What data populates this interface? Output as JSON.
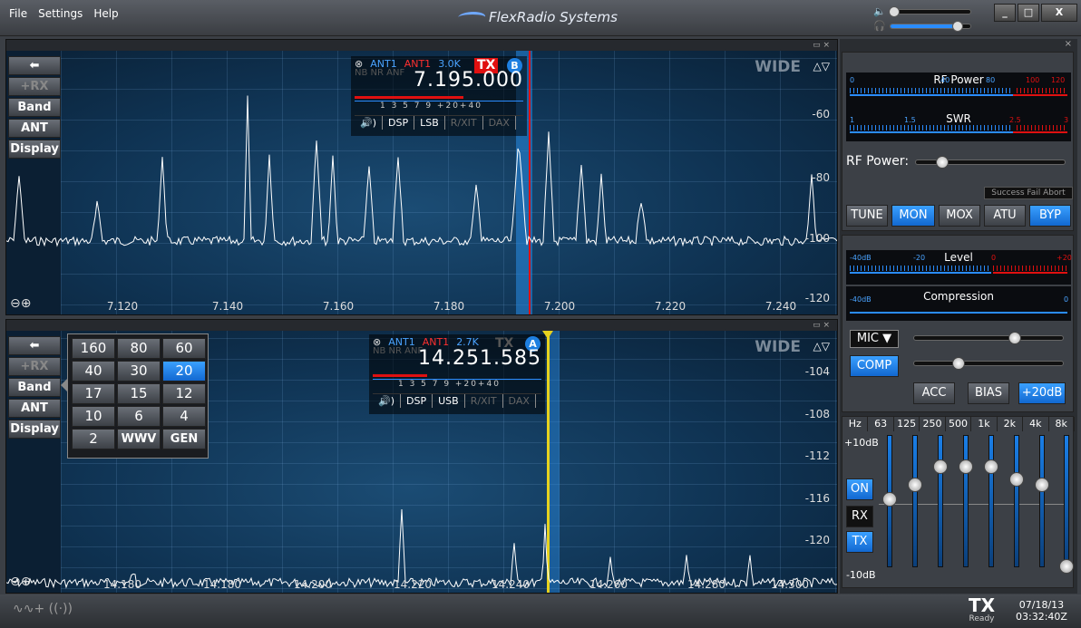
{
  "app": {
    "menu": [
      "File",
      "Settings",
      "Help"
    ],
    "brand": "FlexRadio Systems",
    "window_buttons": [
      "_",
      "□",
      "X"
    ]
  },
  "pan_top": {
    "side_buttons": [
      "⬅",
      "+RX",
      "Band",
      "ANT",
      "Display"
    ],
    "mode_label": "WIDE",
    "updown": "△▽",
    "freq_ticks": [
      "7.120",
      "7.140",
      "7.160",
      "7.180",
      "7.200",
      "7.220",
      "7.240"
    ],
    "db_ticks": [
      "-60",
      "-80",
      "-100",
      "-120"
    ],
    "bar_icons": "▭ ×",
    "slice": {
      "close": "⊗",
      "ant1": "ANT1",
      "ant2": "ANT1",
      "bw": "3.0K",
      "tx": "TX",
      "letter": "B",
      "nb": "NB NR ANF",
      "freq": "7.195.000",
      "scale": "1  3  5  7  9 +20+40",
      "controls": [
        "🔊)",
        "DSP",
        "LSB",
        "R/XIT",
        "DAX"
      ]
    }
  },
  "pan_bot": {
    "side_buttons": [
      "⬅",
      "+RX",
      "Band",
      "ANT",
      "Display"
    ],
    "mode_label": "WIDE",
    "updown": "△▽",
    "freq_ticks": [
      "14.180",
      "14.180",
      "14.200",
      "14.220",
      "14.240",
      "14.260",
      "14.280",
      "14.300"
    ],
    "db_ticks": [
      "-104",
      "-108",
      "-112",
      "-116",
      "-120"
    ],
    "bar_icons": "▭ ×",
    "slice": {
      "close": "⊗",
      "ant1": "ANT1",
      "ant2": "ANT1",
      "bw": "2.7K",
      "tx": "TX",
      "letter": "A",
      "nb": "NB NR ANF",
      "freq": "14.251.585",
      "scale": "1  3  5  7  9 +20+40",
      "controls": [
        "🔊)",
        "DSP",
        "USB",
        "R/XIT",
        "DAX"
      ]
    },
    "band_popup": [
      "160",
      "80",
      "60",
      "40",
      "30",
      "20",
      "17",
      "15",
      "12",
      "10",
      "6",
      "4",
      "2",
      "WWV",
      "GEN"
    ],
    "band_selected": "20"
  },
  "right_panel": {
    "close": "×",
    "rf_meter": {
      "title": "RF Power",
      "nums": [
        "0",
        "40",
        "80",
        "100",
        "120"
      ]
    },
    "swr_meter": {
      "title": "SWR",
      "nums": [
        "1",
        "1.5",
        "2.5",
        "3"
      ]
    },
    "rf_power_label": "RF Power:",
    "status_text": "Success Fail Abort",
    "tx_buttons": [
      "TUNE",
      "MON",
      "MOX",
      "ATU",
      "BYP"
    ],
    "level_meter": {
      "title": "Level",
      "nums": [
        "-40dB",
        "-20",
        "0",
        "+20"
      ]
    },
    "comp_meter": {
      "title": "Compression",
      "nums": [
        "-40dB",
        "0"
      ]
    },
    "mic_select": "MIC ▼",
    "comp_button": "COMP",
    "audio_buttons": [
      "ACC",
      "BIAS",
      "+20dB"
    ],
    "eq_head": [
      "Hz",
      "63",
      "125",
      "250",
      "500",
      "1k",
      "2k",
      "4k",
      "8k"
    ],
    "eq_top": "+10dB",
    "eq_bottom": "-10dB",
    "eq_buttons": [
      "ON",
      "RX",
      "TX"
    ]
  },
  "status": {
    "tx": "TX",
    "tx_sub": "Ready",
    "date": "07/18/13",
    "time": "03:32:40Z",
    "icons": "∿∿+ ((·))"
  },
  "colors": {
    "accent": "#1e7fe0",
    "tx_red": "#e01010",
    "pan_bg": "#0f3353"
  }
}
